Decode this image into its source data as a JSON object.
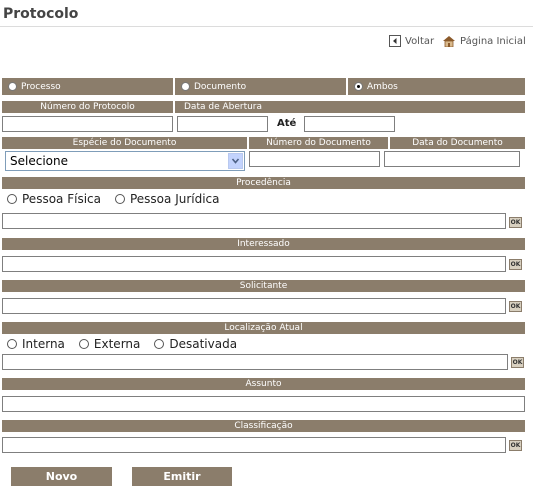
{
  "page": {
    "title": "Protocolo"
  },
  "nav": {
    "back_label": "Voltar",
    "home_label": "Página Inicial"
  },
  "type_options": {
    "processo": "Processo",
    "documento": "Documento",
    "ambos": "Ambos",
    "selected": "Ambos"
  },
  "labels": {
    "numero_protocolo": "Número do Protocolo",
    "data_abertura": "Data de Abertura",
    "ate": "Até",
    "especie_documento": "Espécie do Documento",
    "numero_documento": "Número do Documento",
    "data_documento": "Data do Documento",
    "procedencia": "Procedência",
    "interessado": "Interessado",
    "solicitante": "Solicitante",
    "localizacao_atual": "Localização Atual",
    "assunto": "Assunto",
    "classificacao": "Classificação"
  },
  "especie_select": {
    "value": "Selecione"
  },
  "procedencia_options": [
    "Pessoa Física",
    "Pessoa Jurídica"
  ],
  "localizacao_options": [
    "Interna",
    "Externa",
    "Desativada"
  ],
  "ok_label": "OK",
  "buttons": {
    "novo": "Novo",
    "emitir": "Emitir"
  },
  "colors": {
    "bar": "#8b7d6b",
    "select_arrow": "#c3d3fd"
  }
}
